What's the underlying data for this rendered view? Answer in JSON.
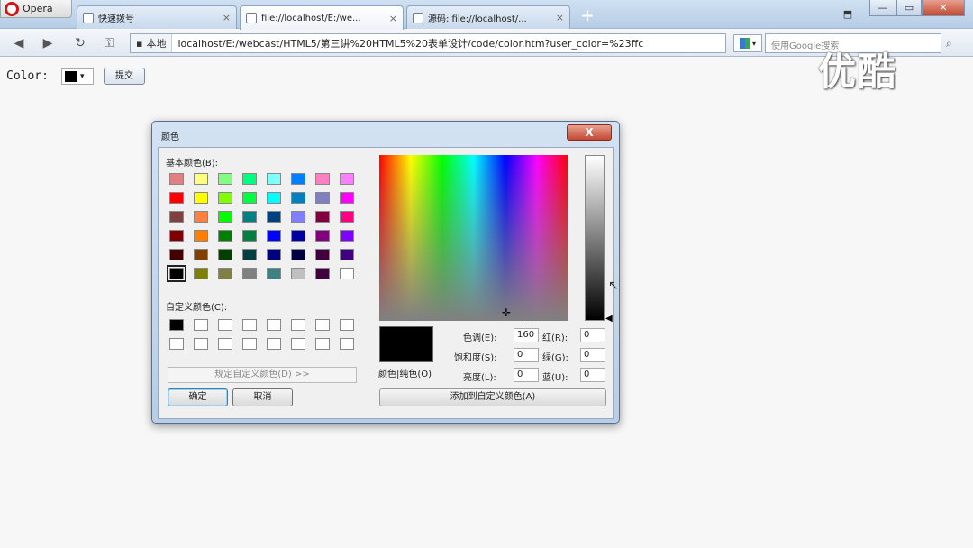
{
  "browser": {
    "opera_label": "Opera",
    "tabs": [
      {
        "title": "快速拨号",
        "close": "×"
      },
      {
        "title": "file://localhost/E:/we...",
        "close": "×"
      },
      {
        "title": "源码: file://localhost/...",
        "close": "×"
      }
    ],
    "new_tab": "+",
    "win_buttons": {
      "minimize": "—",
      "maximize": "▭",
      "close": "✕"
    },
    "address": {
      "local_label": "本地",
      "url": "localhost/E:/webcast/HTML5/第三讲%20HTML5%20表单设计/code/color.htm?user_color=%23ffc"
    },
    "search": {
      "placeholder": "使用Google搜索"
    }
  },
  "watermark": "优酷",
  "page": {
    "color_label": "Color:",
    "color_value": "#000000",
    "dropdown_arrow": "▾",
    "submit_label": "提交"
  },
  "dialog": {
    "title": "颜色",
    "close_label": "X",
    "basic_colors_label": "基本颜色(B):",
    "basic_colors": [
      "#e08080",
      "#ffff80",
      "#80ff80",
      "#00ff80",
      "#80ffff",
      "#0080ff",
      "#ff80c0",
      "#ff80ff",
      "#ff0000",
      "#ffff00",
      "#80ff00",
      "#00ff40",
      "#00ffff",
      "#0080c0",
      "#8080c0",
      "#ff00ff",
      "#804040",
      "#ff8040",
      "#00ff00",
      "#008080",
      "#004080",
      "#8080ff",
      "#800040",
      "#ff0080",
      "#800000",
      "#ff8000",
      "#008000",
      "#008040",
      "#0000ff",
      "#0000a0",
      "#800080",
      "#8000ff",
      "#400000",
      "#804000",
      "#004000",
      "#004040",
      "#000080",
      "#000040",
      "#400040",
      "#400080",
      "#000000",
      "#808000",
      "#808040",
      "#808080",
      "#408080",
      "#c0c0c0",
      "#400040",
      "#ffffff"
    ],
    "selected_basic_index": 40,
    "custom_colors_label": "自定义颜色(C):",
    "custom_colors": [
      "#000000"
    ],
    "define_button": "规定自定义颜色(D) >>",
    "ok_button": "确定",
    "cancel_button": "取消",
    "crosshair": "✛",
    "lum_arrow": "◀",
    "preview_label": "颜色|纯色(O)",
    "hue_label": "色调(E):",
    "hue": "160",
    "sat_label": "饱和度(S):",
    "sat": "0",
    "lum_label": "亮度(L):",
    "lum": "0",
    "red_label": "红(R):",
    "red": "0",
    "green_label": "绿(G):",
    "green": "0",
    "blue_label": "蓝(U):",
    "blue": "0",
    "add_button": "添加到自定义颜色(A)"
  },
  "cursor": "↖"
}
